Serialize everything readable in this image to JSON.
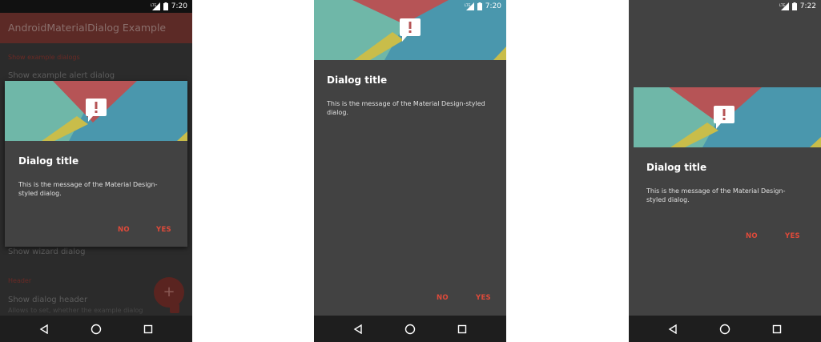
{
  "status": {
    "time1": "7:20",
    "time2": "7:20",
    "time3": "7:22",
    "network": "LTE"
  },
  "app": {
    "title": "AndroidMaterialDialog Example",
    "section_show_examples": "Show example dialogs",
    "item_alert": "Show example alert dialog",
    "item_wizard": "Show wizard dialog",
    "section_header": "Header",
    "item_show_header": "Show dialog header",
    "item_show_header_summary": "Allows to set, whether the example dialog",
    "fab_label": "+"
  },
  "dialog": {
    "title": "Dialog title",
    "message": "This is the message of the Material Design-styled dialog.",
    "message_line1_a": "This is the message of the Material Design-",
    "message_line2_a": "styled dialog.",
    "message_line1_b": "This is the message of the Material Design-styled",
    "message_line2_b": "dialog.",
    "negative": "NO",
    "positive": "YES",
    "header_icon": "alert-bubble-icon"
  },
  "colors": {
    "accent": "#e04a3a",
    "dialog_bg": "#424242",
    "header_teal": "#6fb7a8",
    "header_blue": "#4a97ad",
    "header_red": "#b65456",
    "header_yellow": "#c9bd4a"
  }
}
